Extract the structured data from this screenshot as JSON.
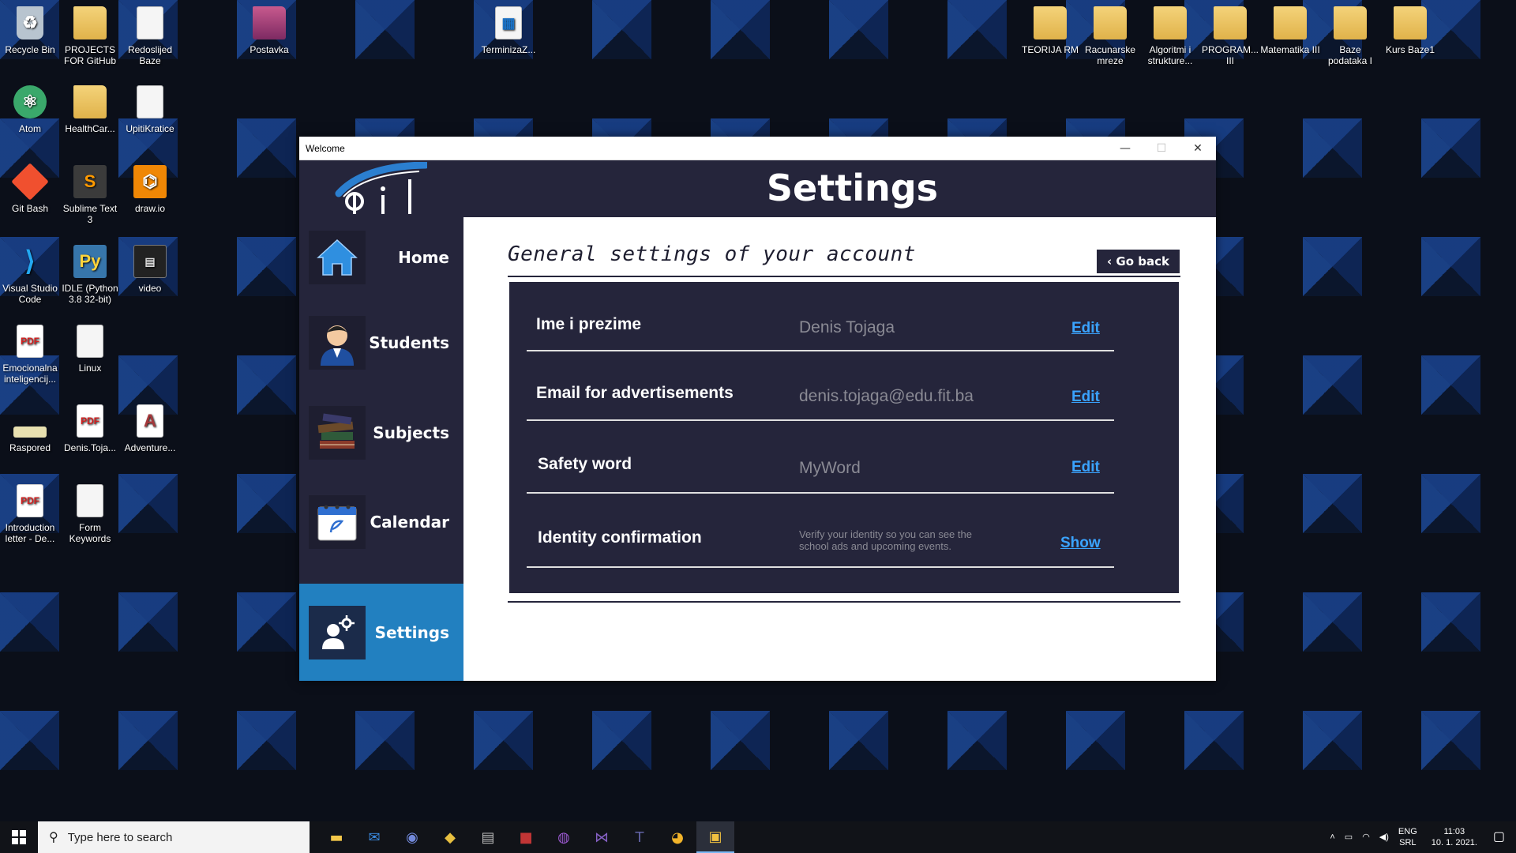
{
  "desktop": {
    "icons": [
      {
        "label": "Recycle Bin",
        "icon": "recycle-bin-icon"
      },
      {
        "label": "PROJECTS FOR GitHub",
        "icon": "folder-icon"
      },
      {
        "label": "Redoslijed Baze",
        "icon": "document-icon"
      },
      {
        "label": "Postavka",
        "icon": "winrar-icon"
      },
      {
        "label": "TerminizaZ...",
        "icon": "calendar-file-icon"
      },
      {
        "label": "TEORIJA RM",
        "icon": "folder-icon"
      },
      {
        "label": "Racunarske mreze",
        "icon": "folder-icon"
      },
      {
        "label": "Algoritmi i strukture...",
        "icon": "folder-icon"
      },
      {
        "label": "PROGRAM... III",
        "icon": "pdf-folder-icon"
      },
      {
        "label": "Matematika III",
        "icon": "folder-icon"
      },
      {
        "label": "Baze podataka I",
        "icon": "folder-icon"
      },
      {
        "label": "Kurs Baze1",
        "icon": "folder-icon"
      },
      {
        "label": "Atom",
        "icon": "atom-icon"
      },
      {
        "label": "HealthCar...",
        "icon": "folder-icon"
      },
      {
        "label": "UpitiKratice",
        "icon": "document-icon"
      },
      {
        "label": "Git Bash",
        "icon": "git-icon"
      },
      {
        "label": "Sublime Text 3",
        "icon": "sublime-icon"
      },
      {
        "label": "draw.io",
        "icon": "drawio-icon"
      },
      {
        "label": "Visual Studio Code",
        "icon": "vscode-icon"
      },
      {
        "label": "IDLE (Python 3.8 32-bit)",
        "icon": "python-icon"
      },
      {
        "label": "video",
        "icon": "video-icon"
      },
      {
        "label": "Emocionalna inteligencij...",
        "icon": "pdf-icon"
      },
      {
        "label": "Linux",
        "icon": "document-icon"
      },
      {
        "label": "Raspored",
        "icon": "image-icon"
      },
      {
        "label": "Denis.Toja...",
        "icon": "pdf-icon"
      },
      {
        "label": "Adventure...",
        "icon": "access-icon"
      },
      {
        "label": "Introduction letter - De...",
        "icon": "pdf-icon"
      },
      {
        "label": "Form Keywords",
        "icon": "document-icon"
      }
    ]
  },
  "window": {
    "title": "Welcome",
    "minimize": "—",
    "maximize": "☐",
    "close": "✕"
  },
  "app": {
    "header_title": "Settings",
    "nav": [
      {
        "label": "Home",
        "icon": "home-icon",
        "active": false
      },
      {
        "label": "Students",
        "icon": "student-icon",
        "active": false
      },
      {
        "label": "Subjects",
        "icon": "books-icon",
        "active": false
      },
      {
        "label": "Calendar",
        "icon": "calendar-icon",
        "active": false
      },
      {
        "label": "Settings",
        "icon": "user-settings-icon",
        "active": true
      }
    ],
    "section_title": "General settings of your account",
    "goback_label": "‹ Go back",
    "settings": [
      {
        "label": "Ime i prezime",
        "value": "Denis Tojaga",
        "action": "Edit"
      },
      {
        "label": "Email for advertisements",
        "value": "denis.tojaga@edu.fit.ba",
        "action": "Edit"
      },
      {
        "label": "Safety word",
        "value": "MyWord",
        "action": "Edit"
      },
      {
        "label": "Identity confirmation",
        "value": "Verify your identity so you can see the school ads and upcoming events.",
        "action": "Show"
      }
    ]
  },
  "taskbar": {
    "search_placeholder": "Type here to search",
    "language": "ENG",
    "layout": "SRL",
    "time": "11:03",
    "date": "10. 1. 2021."
  }
}
